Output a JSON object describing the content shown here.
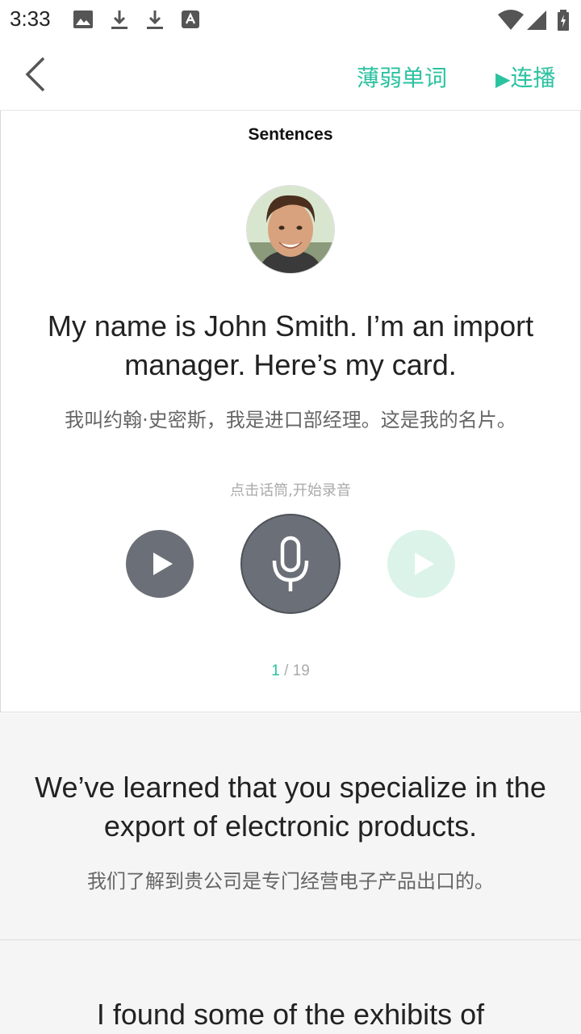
{
  "status_bar": {
    "time": "3:33",
    "icons": [
      "image-icon",
      "download-icon",
      "download-icon",
      "font-icon",
      "wifi-icon",
      "signal-icon",
      "battery-icon"
    ]
  },
  "header": {
    "weak_words_label": "薄弱单词",
    "play_all_label": "连播",
    "play_all_icon": "▶"
  },
  "current": {
    "section_title": "Sentences",
    "sentence_en": "My name is John Smith. I’m an import manager. Here’s my card.",
    "sentence_cn": "我叫约翰·史密斯，我是进口部经理。这是我的名片。",
    "hint": "点击话筒,开始录音"
  },
  "pager": {
    "current": "1",
    "total": "/ 19"
  },
  "list": [
    {
      "sentence_en": "We’ve learned that you specialize in the export of electronic products.",
      "sentence_cn": "我们了解到贵公司是专门经营电子产品出口的。"
    },
    {
      "sentence_en": "I found some of the exhibits of",
      "sentence_cn": ""
    }
  ],
  "colors": {
    "accent": "#2bc2a0",
    "button_gray": "#6b6f77",
    "playback_disabled": "#dcf3ea"
  }
}
